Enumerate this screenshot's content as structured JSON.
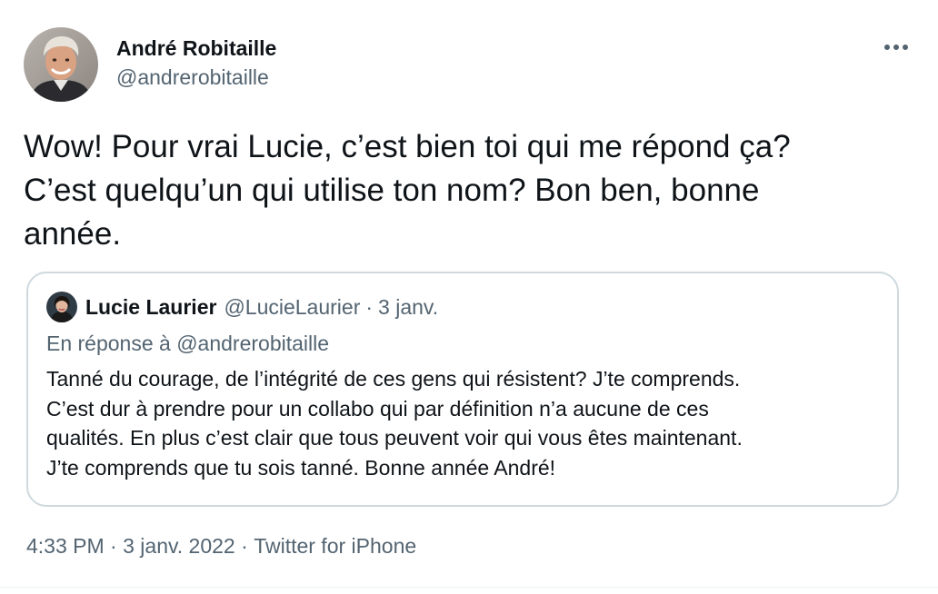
{
  "author": {
    "display_name": "André Robitaille",
    "handle": "@andrerobitaille"
  },
  "tweet": {
    "text": "Wow! Pour vrai Lucie, c’est bien toi qui me répond ça?\nC’est quelqu’un qui utilise ton nom? Bon ben, bonne\nannée."
  },
  "quoted_tweet": {
    "display_name": "Lucie Laurier",
    "handle": "@LucieLaurier",
    "separator": "·",
    "date": "3 janv.",
    "reply_context": "En réponse à @andrerobitaille",
    "text": "Tanné du courage, de l’intégrité de ces gens qui résistent? J’te comprends.\nC’est dur à prendre pour un collabo qui par définition n’a aucune de ces\nqualités. En plus c’est clair que tous peuvent voir qui vous êtes maintenant.\nJ’te comprends que tu sois tanné. Bonne année André!"
  },
  "meta": {
    "time": "4:33 PM",
    "sep1": " · ",
    "date": "3 janv. 2022",
    "sep2": " · ",
    "source": "Twitter for iPhone"
  },
  "icons": {
    "more": "more-horizontal-icon"
  },
  "colors": {
    "text_primary": "#0f1419",
    "text_secondary": "#536471",
    "border": "#cfd9de"
  }
}
